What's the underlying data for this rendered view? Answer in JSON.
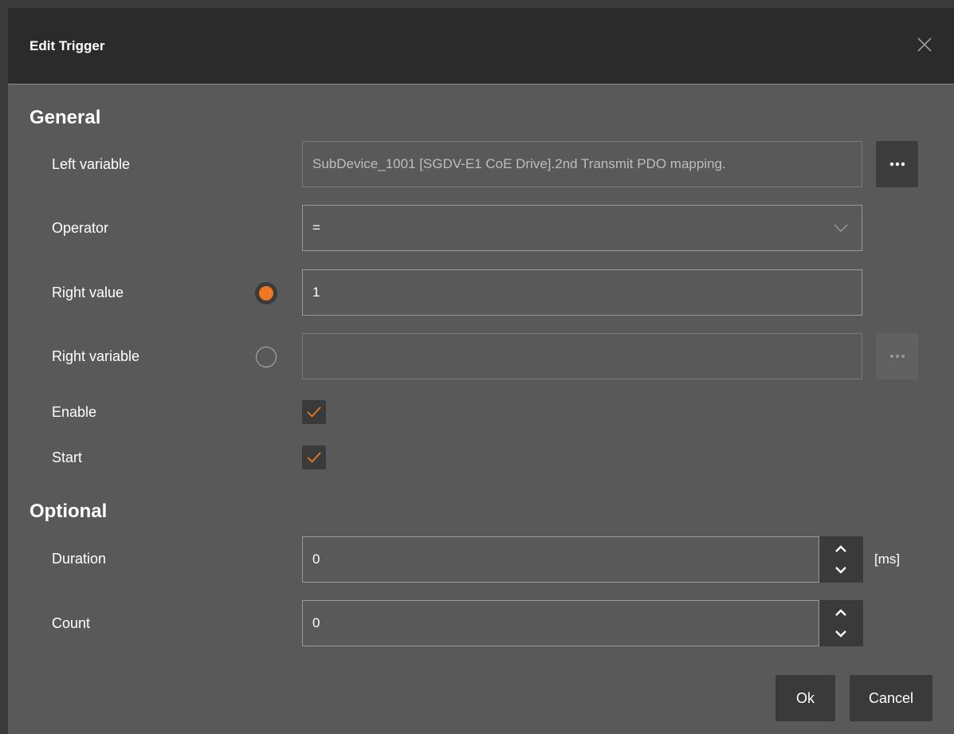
{
  "dialog": {
    "title": "Edit Trigger"
  },
  "general": {
    "heading": "General",
    "left_variable_label": "Left variable",
    "left_variable_value": "SubDevice_1001 [SGDV-E1 CoE Drive].2nd Transmit PDO mapping.",
    "operator_label": "Operator",
    "operator_value": "=",
    "right_value_label": "Right value",
    "right_value_value": "1",
    "right_value_selected": true,
    "right_variable_label": "Right variable",
    "right_variable_value": "",
    "enable_label": "Enable",
    "enable_checked": true,
    "start_label": "Start",
    "start_checked": true
  },
  "optional": {
    "heading": "Optional",
    "duration_label": "Duration",
    "duration_value": "0",
    "duration_unit": "[ms]",
    "count_label": "Count",
    "count_value": "0"
  },
  "buttons": {
    "ok": "Ok",
    "cancel": "Cancel",
    "browse_dots": "..."
  },
  "colors": {
    "accent": "#ed7723",
    "dialog_bg": "#595959",
    "titlebar_bg": "#2b2b2b"
  },
  "icons": {
    "close": "close-icon",
    "browse": "ellipsis-icon",
    "dropdown": "chevron-down-icon",
    "check": "checkmark-icon",
    "spin_up": "chevron-up-icon",
    "spin_down": "chevron-down-icon"
  }
}
